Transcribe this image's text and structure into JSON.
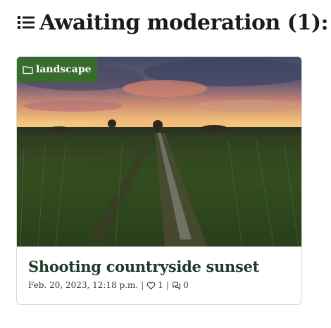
{
  "heading": {
    "icon": "list-icon",
    "text": "Awaiting moderation (1):"
  },
  "card": {
    "category": {
      "icon": "folder-icon",
      "label": "landscape",
      "color": "#386c2c"
    },
    "image": {
      "description_icon": "countryside-sunset-photo"
    },
    "title": "Shooting countryside sunset",
    "date": "Feb. 20, 2023, 12:18 p.m.",
    "separator": "|",
    "likes": {
      "icon": "heart-icon",
      "count": "1"
    },
    "comments": {
      "icon": "comments-icon",
      "count": "0"
    }
  },
  "colors": {
    "title_green": "#1f3b2a",
    "tag_green": "#386c2c"
  }
}
